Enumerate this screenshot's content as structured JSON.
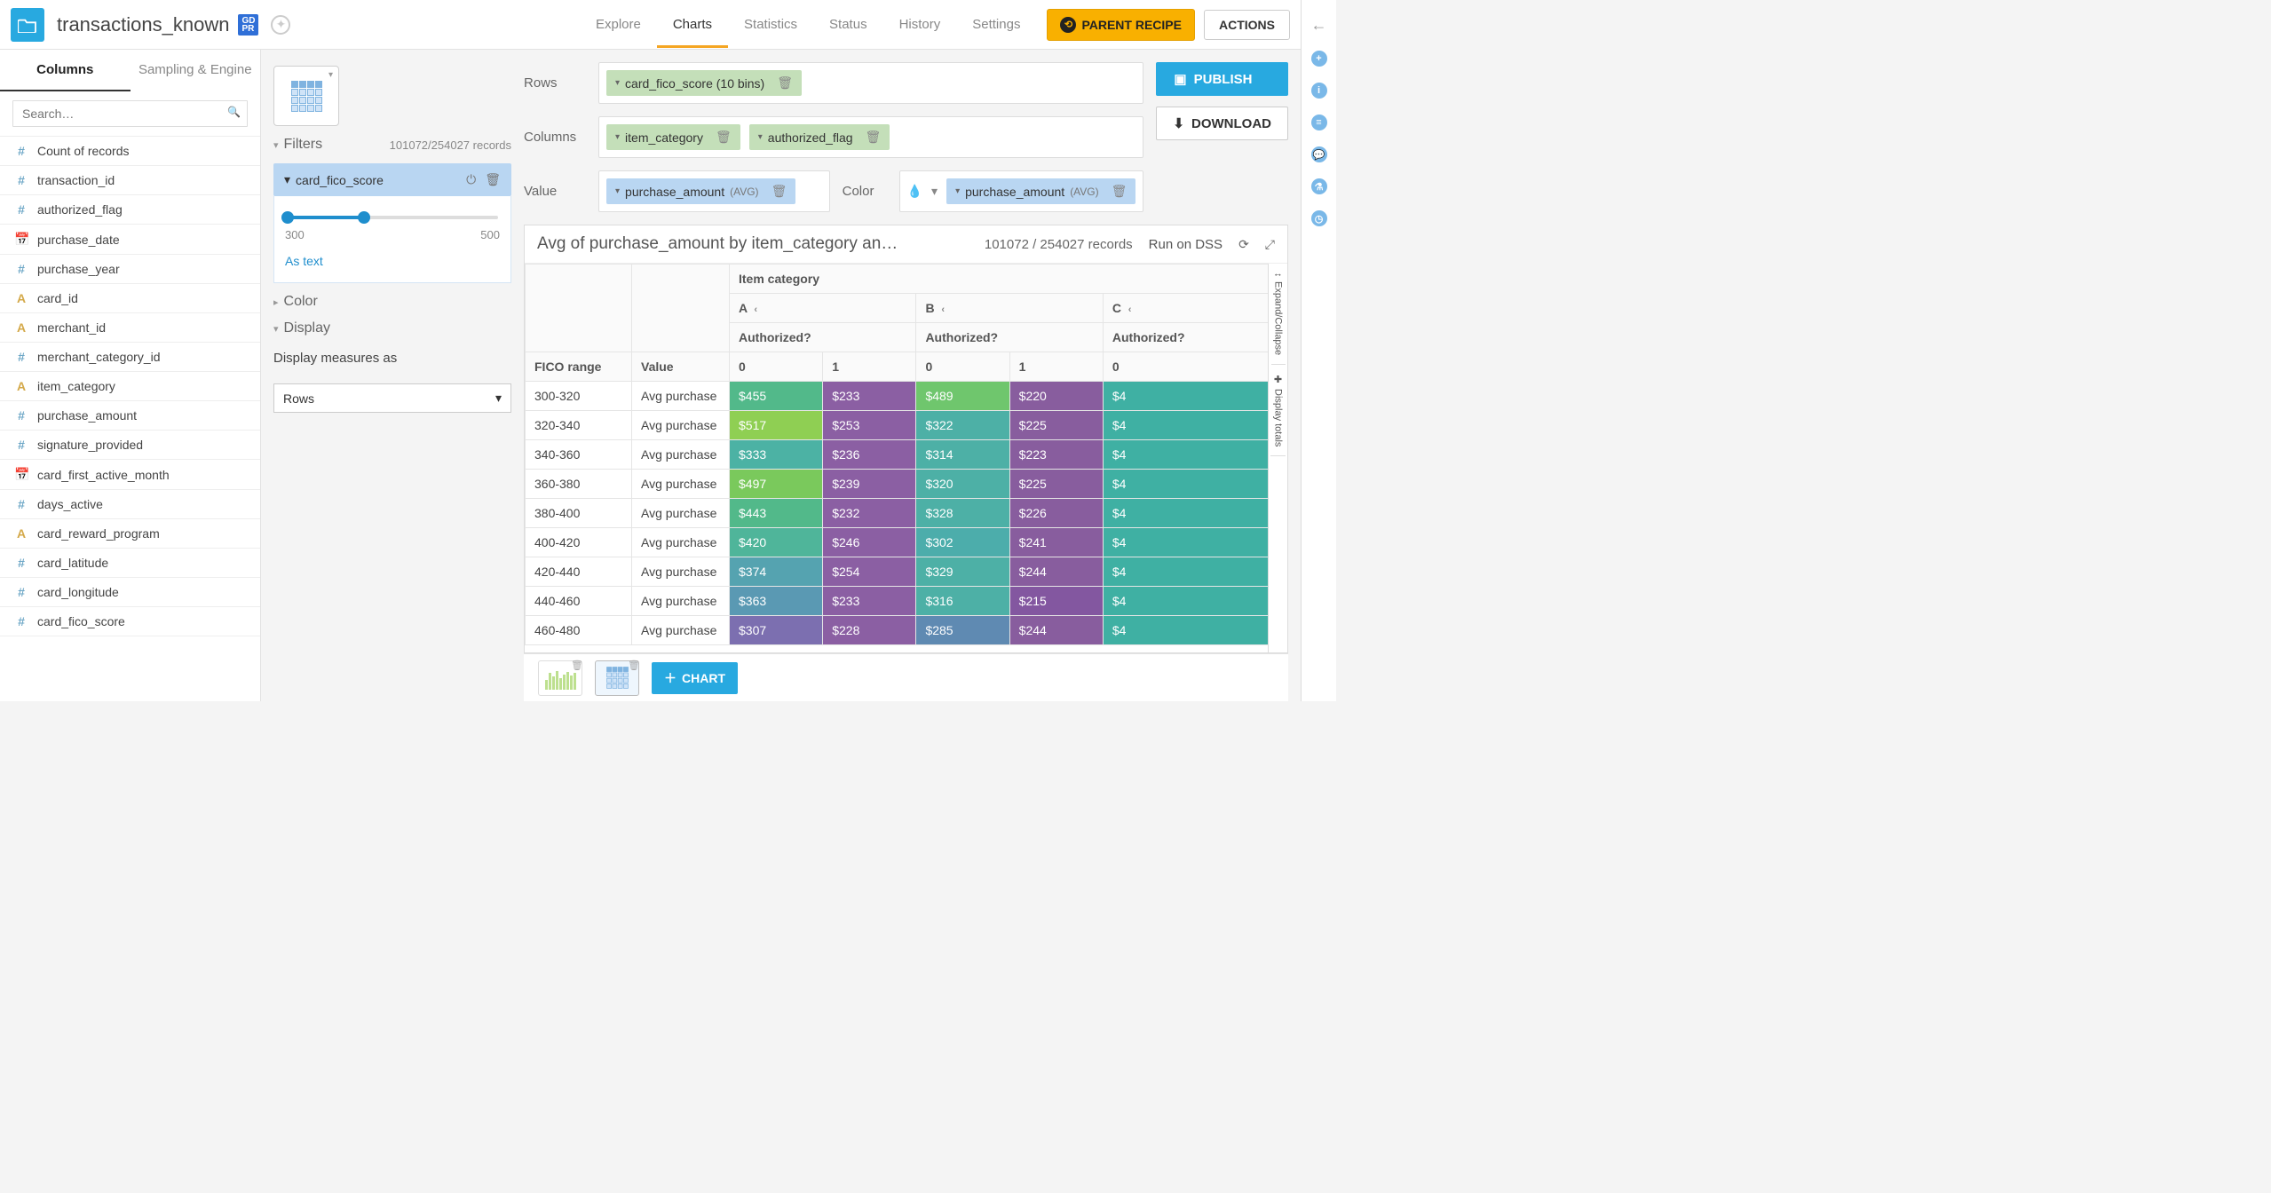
{
  "header": {
    "dataset_name": "transactions_known",
    "gdpr_badge": "GD\nPR",
    "tabs": [
      "Explore",
      "Charts",
      "Statistics",
      "Status",
      "History",
      "Settings"
    ],
    "active_tab": 1,
    "parent_recipe": "PARENT RECIPE",
    "actions": "ACTIONS"
  },
  "left": {
    "tabs": [
      "Columns",
      "Sampling & Engine"
    ],
    "active": 0,
    "search_placeholder": "Search…",
    "columns": [
      {
        "icon": "hash",
        "name": "Count of records"
      },
      {
        "icon": "hash",
        "name": "transaction_id"
      },
      {
        "icon": "hash",
        "name": "authorized_flag"
      },
      {
        "icon": "date",
        "name": "purchase_date"
      },
      {
        "icon": "hash",
        "name": "purchase_year"
      },
      {
        "icon": "text",
        "name": "card_id"
      },
      {
        "icon": "text",
        "name": "merchant_id"
      },
      {
        "icon": "hash",
        "name": "merchant_category_id"
      },
      {
        "icon": "text",
        "name": "item_category"
      },
      {
        "icon": "hash",
        "name": "purchase_amount"
      },
      {
        "icon": "hash",
        "name": "signature_provided"
      },
      {
        "icon": "date",
        "name": "card_first_active_month"
      },
      {
        "icon": "hash",
        "name": "days_active"
      },
      {
        "icon": "text",
        "name": "card_reward_program"
      },
      {
        "icon": "hash",
        "name": "card_latitude"
      },
      {
        "icon": "hash",
        "name": "card_longitude"
      },
      {
        "icon": "hash",
        "name": "card_fico_score"
      }
    ]
  },
  "mid": {
    "filters_label": "Filters",
    "records_text": "101072/254027 records",
    "filter_name": "card_fico_score",
    "slider_min": "300",
    "slider_max": "500",
    "as_text": "As text",
    "color_label": "Color",
    "display_label": "Display",
    "display_measures_label": "Display measures as",
    "display_measures_value": "Rows"
  },
  "cfg": {
    "rows_label": "Rows",
    "rows_pill": "card_fico_score (10 bins)",
    "columns_label": "Columns",
    "col_pill1": "item_category",
    "col_pill2": "authorized_flag",
    "value_label": "Value",
    "value_pill": "purchase_amount",
    "value_agg": "(AVG)",
    "color_label": "Color",
    "color_pill": "purchase_amount",
    "color_agg": "(AVG)",
    "publish": "PUBLISH",
    "download": "DOWNLOAD"
  },
  "chart": {
    "title": "Avg of purchase_amount by item_category an…",
    "records": "101072 / 254027 records",
    "run_on": "Run on DSS",
    "col_group_label": "Item category",
    "col_groups": [
      "A",
      "B",
      "C"
    ],
    "auth_label": "Authorized?",
    "auth_vals": [
      "0",
      "1",
      "0",
      "1",
      "0"
    ],
    "row_head": "FICO range",
    "value_head": "Value",
    "row_value_label": "Avg purchase",
    "expand_label": "Expand/Collapse",
    "totals_label": "Display totals"
  },
  "chart_data": {
    "type": "table",
    "title": "Avg of purchase_amount by item_category and authorized_flag",
    "row_dim": "FICO range",
    "col_dims": [
      "item_category",
      "authorized_flag"
    ],
    "measure": "Avg purchase_amount",
    "columns": [
      {
        "item_category": "A",
        "authorized_flag": 0
      },
      {
        "item_category": "A",
        "authorized_flag": 1
      },
      {
        "item_category": "B",
        "authorized_flag": 0
      },
      {
        "item_category": "B",
        "authorized_flag": 1
      },
      {
        "item_category": "C",
        "authorized_flag": 0
      }
    ],
    "rows": [
      {
        "range": "300-320",
        "values": [
          455,
          233,
          489,
          220,
          null
        ],
        "colors": [
          "#52b98a",
          "#8b5fa3",
          "#6fc66d",
          "#885d9e",
          "#3fb0a3"
        ]
      },
      {
        "range": "320-340",
        "values": [
          517,
          253,
          322,
          225,
          null
        ],
        "colors": [
          "#8fcf53",
          "#8b5fa3",
          "#4db0a6",
          "#885d9e",
          "#3fb0a3"
        ]
      },
      {
        "range": "340-360",
        "values": [
          333,
          236,
          314,
          223,
          null
        ],
        "colors": [
          "#4cb2a4",
          "#8b5fa3",
          "#4db0a6",
          "#885d9e",
          "#3fb0a3"
        ]
      },
      {
        "range": "360-380",
        "values": [
          497,
          239,
          320,
          225,
          null
        ],
        "colors": [
          "#7ac95c",
          "#8b5fa3",
          "#4db0a6",
          "#885d9e",
          "#3fb0a3"
        ]
      },
      {
        "range": "380-400",
        "values": [
          443,
          232,
          328,
          226,
          null
        ],
        "colors": [
          "#52b98a",
          "#8b5fa3",
          "#4db0a6",
          "#885d9e",
          "#3fb0a3"
        ]
      },
      {
        "range": "400-420",
        "values": [
          420,
          246,
          302,
          241,
          null
        ],
        "colors": [
          "#4fb59a",
          "#8b5fa3",
          "#4cadab",
          "#885d9e",
          "#3fb0a3"
        ]
      },
      {
        "range": "420-440",
        "values": [
          374,
          254,
          329,
          244,
          null
        ],
        "colors": [
          "#55a3b0",
          "#8b5fa3",
          "#4db0a6",
          "#885d9e",
          "#3fb0a3"
        ]
      },
      {
        "range": "440-460",
        "values": [
          363,
          233,
          316,
          215,
          null
        ],
        "colors": [
          "#5a99b3",
          "#8b5fa3",
          "#4db0a6",
          "#8357a0",
          "#3fb0a3"
        ]
      },
      {
        "range": "460-480",
        "values": [
          307,
          228,
          285,
          244,
          null
        ],
        "colors": [
          "#7c6fb0",
          "#8b5fa3",
          "#5f8ab2",
          "#885d9e",
          "#3fb0a3"
        ]
      }
    ]
  },
  "footer": {
    "add_chart": "CHART"
  }
}
